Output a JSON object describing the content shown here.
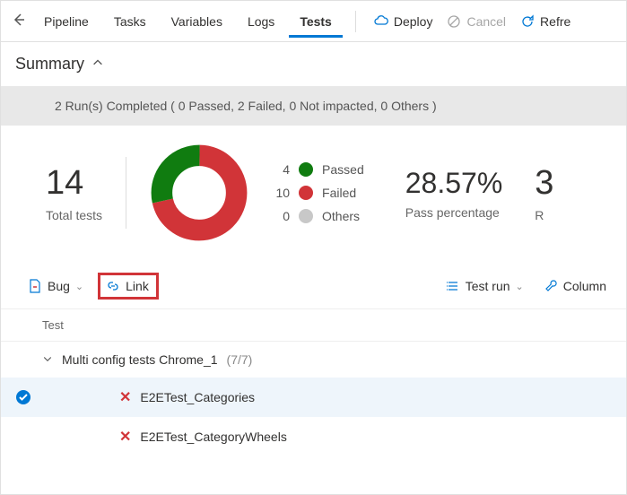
{
  "topbar": {
    "tabs": [
      "Pipeline",
      "Tasks",
      "Variables",
      "Logs",
      "Tests"
    ],
    "active_tab": 4,
    "deploy": "Deploy",
    "cancel": "Cancel",
    "refresh": "Refre"
  },
  "summary": {
    "title": "Summary"
  },
  "status_line": "2 Run(s) Completed ( 0 Passed, 2 Failed, 0 Not impacted, 0 Others )",
  "stats": {
    "total": "14",
    "total_label": "Total tests",
    "legend": [
      {
        "count": "4",
        "label": "Passed",
        "color": "#107c10"
      },
      {
        "count": "10",
        "label": "Failed",
        "color": "#d13438"
      },
      {
        "count": "0",
        "label": "Others",
        "color": "#c8c8c8"
      }
    ],
    "pass_pct": "28.57%",
    "pass_label": "Pass percentage",
    "edge_num": "3",
    "edge_label": "R"
  },
  "toolbar": {
    "bug": "Bug",
    "link": "Link",
    "testrun": "Test run",
    "columns": "Column"
  },
  "list": {
    "header": "Test",
    "group": {
      "name": "Multi config tests Chrome_1",
      "count": "(7/7)"
    },
    "rows": [
      {
        "name": "E2ETest_Categories",
        "selected": true
      },
      {
        "name": "E2ETest_CategoryWheels",
        "selected": false
      }
    ]
  },
  "chart_data": {
    "type": "pie",
    "title": "Test results",
    "categories": [
      "Passed",
      "Failed",
      "Others"
    ],
    "values": [
      4,
      10,
      0
    ],
    "colors": [
      "#107c10",
      "#d13438",
      "#c8c8c8"
    ]
  }
}
